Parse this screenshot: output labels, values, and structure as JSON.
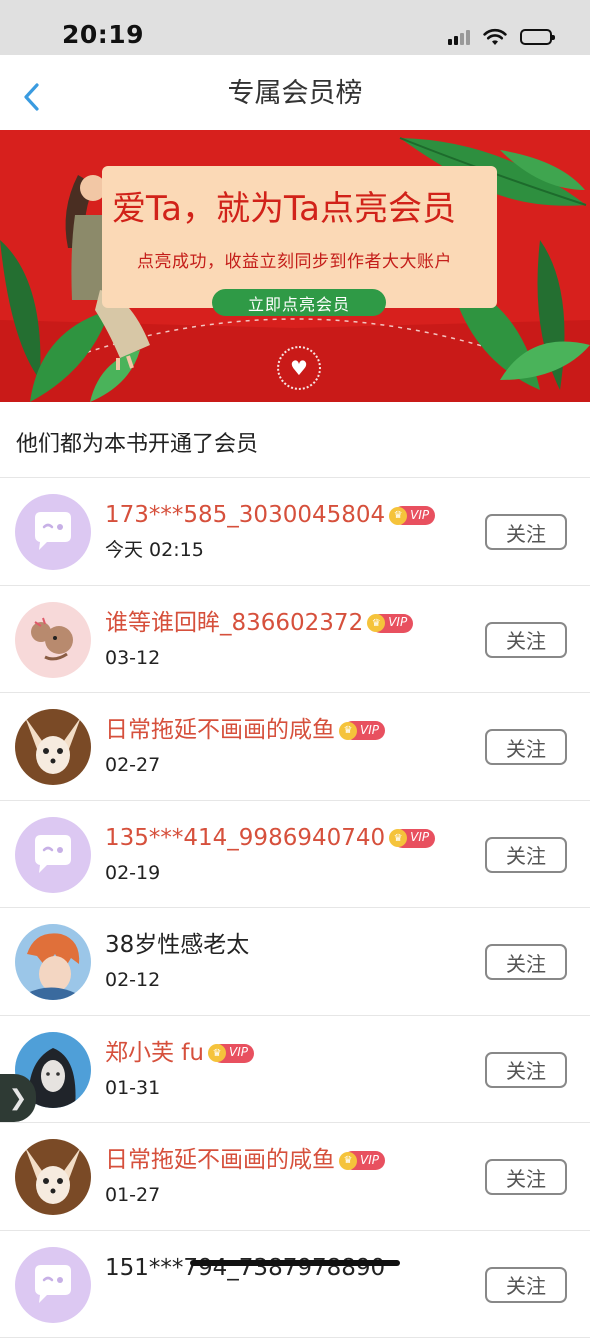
{
  "status_bar": {
    "time": "20:19"
  },
  "nav": {
    "title": "专属会员榜"
  },
  "banner": {
    "headline": "爱Ta，就为Ta点亮会员",
    "subtitle": "点亮成功，收益立刻同步到作者大大账户",
    "cta_label": "立即点亮会员",
    "colors": {
      "background": "#d7201d",
      "card": "#fbd9b6",
      "cta": "#2f9a46"
    }
  },
  "section_title": "他们都为本书开通了会员",
  "follow_label": "关注",
  "vip_label": "VIP",
  "members": [
    {
      "name": "173***585_3030045804",
      "date": "今天 02:15",
      "vip": true,
      "avatar": "chat-bubble-avatar"
    },
    {
      "name": "谁等谁回眸_836602372",
      "date": "03-12",
      "vip": true,
      "avatar": "cartoon-mouse-avatar"
    },
    {
      "name": "日常拖延不画画的咸鱼",
      "date": "02-27",
      "vip": true,
      "avatar": "fox-avatar"
    },
    {
      "name": "135***414_9986940740",
      "date": "02-19",
      "vip": true,
      "avatar": "chat-bubble-avatar"
    },
    {
      "name": "38岁性感老太",
      "date": "02-12",
      "vip": false,
      "avatar": "anime-avatar"
    },
    {
      "name": "郑小芙 fu",
      "date": "01-31",
      "vip": true,
      "avatar": "portrait-avatar"
    },
    {
      "name": "日常拖延不画画的咸鱼",
      "date": "01-27",
      "vip": true,
      "avatar": "fox-avatar"
    },
    {
      "name": "151***794_7387978890",
      "date": "",
      "vip": false,
      "avatar": "chat-bubble-avatar"
    }
  ],
  "side_tab": {
    "glyph": "❯"
  }
}
